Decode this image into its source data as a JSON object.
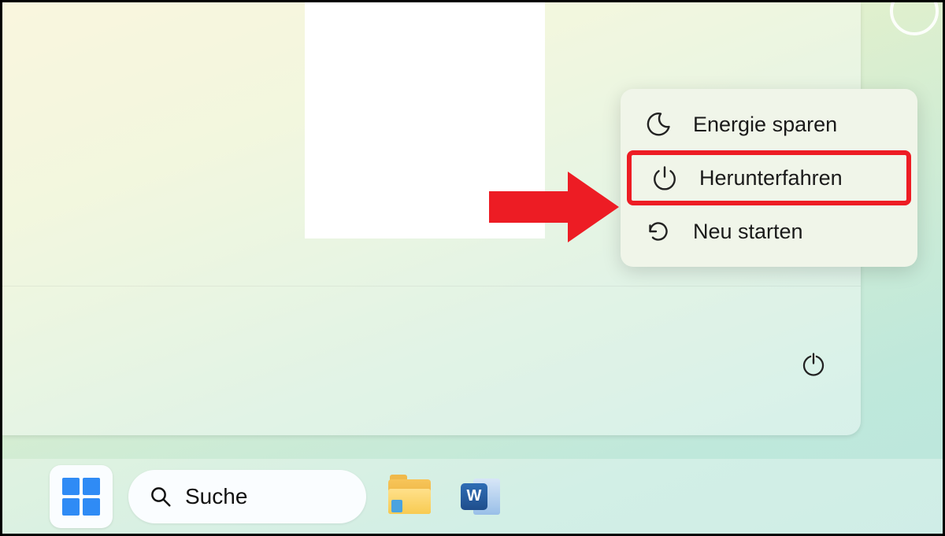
{
  "power_menu": {
    "items": [
      {
        "label": "Energie sparen",
        "icon": "moon-icon"
      },
      {
        "label": "Herunterfahren",
        "icon": "power-icon"
      },
      {
        "label": "Neu starten",
        "icon": "restart-icon"
      }
    ],
    "highlighted_index": 1
  },
  "taskbar": {
    "search_label": "Suche",
    "word_letter": "W"
  },
  "annotation": {
    "highlight_color": "#ed1c24"
  }
}
